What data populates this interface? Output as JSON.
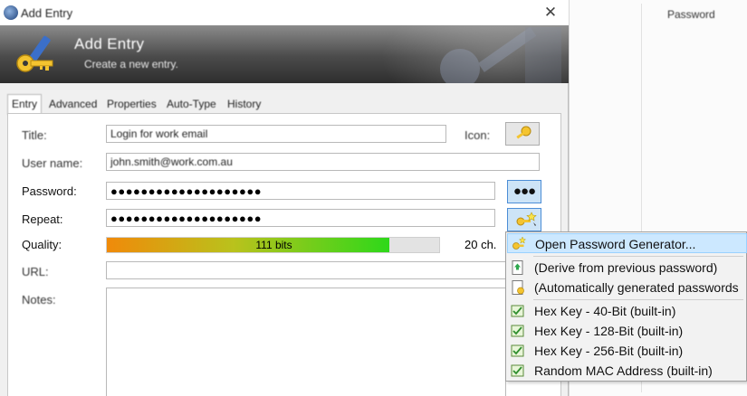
{
  "window": {
    "title": "Add Entry",
    "close_glyph": "✕"
  },
  "banner": {
    "title": "Add Entry",
    "subtitle": "Create a new entry."
  },
  "tabs": [
    {
      "label": "Entry",
      "active": true
    },
    {
      "label": "Advanced"
    },
    {
      "label": "Properties"
    },
    {
      "label": "Auto-Type"
    },
    {
      "label": "History"
    }
  ],
  "form": {
    "title_label": "Title:",
    "title_value": "Login for work email",
    "icon_label": "Icon:",
    "username_label": "User name:",
    "username_value": "john.smith@work.com.au",
    "password_label": "Password:",
    "password_value": "●●●●●●●●●●●●●●●●●●●●",
    "repeat_label": "Repeat:",
    "repeat_value": "●●●●●●●●●●●●●●●●●●●●",
    "show_password_button": "●●●",
    "quality_label": "Quality:",
    "quality_bits": "111 bits",
    "quality_fraction": 0.85,
    "quality_chars": "20 ch.",
    "url_label": "URL:",
    "notes_label": "Notes:"
  },
  "background_window": {
    "column_header": "Password"
  },
  "generator_menu": {
    "items": [
      {
        "label": "Open Password Generator...",
        "icon": "wand-key-icon",
        "highlighted": true
      },
      {
        "label": "(Derive from previous password)",
        "icon": "derive-icon"
      },
      {
        "label": "(Automatically generated passwords",
        "icon": "auto-generate-icon"
      },
      {
        "label": "Hex Key - 40-Bit (built-in)",
        "icon": "profile-icon"
      },
      {
        "label": "Hex Key - 128-Bit (built-in)",
        "icon": "profile-icon"
      },
      {
        "label": "Hex Key - 256-Bit (built-in)",
        "icon": "profile-icon"
      },
      {
        "label": "Random MAC Address (built-in)",
        "icon": "profile-icon"
      }
    ]
  },
  "colors": {
    "menu_highlight": "#cce8ff",
    "quality_start": "#f08a0a",
    "quality_end": "#2ed81a",
    "button_accent": "#cde4f7"
  }
}
